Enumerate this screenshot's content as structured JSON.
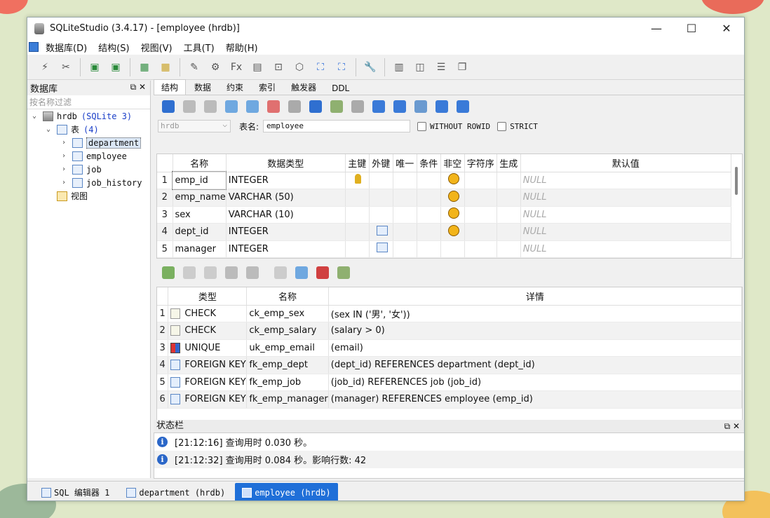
{
  "window": {
    "title": "SQLiteStudio (3.4.17) - [employee (hrdb)]"
  },
  "menu": [
    "数据库(D)",
    "结构(S)",
    "视图(V)",
    "工具(T)",
    "帮助(H)"
  ],
  "sidebar": {
    "title": "数据库",
    "filter_placeholder": "按名称过滤",
    "db_name": "hrdb",
    "db_type": "(SQLite 3)",
    "tables_label": "表",
    "tables_count": "(4)",
    "tables": [
      "department",
      "employee",
      "job",
      "job_history"
    ],
    "views_label": "视图"
  },
  "tabs": [
    "结构",
    "数据",
    "约束",
    "索引",
    "触发器",
    "DDL"
  ],
  "table_form": {
    "db": "hrdb",
    "name_label": "表名:",
    "name": "employee",
    "without_rowid": "WITHOUT ROWID",
    "strict": "STRICT"
  },
  "columns_grid": {
    "headers": [
      "名称",
      "数据类型",
      "主键",
      "外键",
      "唯一",
      "条件",
      "非空",
      "字符序",
      "生成",
      "默认值"
    ],
    "rows": [
      {
        "n": "1",
        "name": "emp_id",
        "type": "INTEGER",
        "pk": true,
        "fk": false,
        "nn": true,
        "default": "NULL"
      },
      {
        "n": "2",
        "name": "emp_name",
        "type": "VARCHAR (50)",
        "pk": false,
        "fk": false,
        "nn": true,
        "default": "NULL"
      },
      {
        "n": "3",
        "name": "sex",
        "type": "VARCHAR (10)",
        "pk": false,
        "fk": false,
        "nn": true,
        "default": "NULL"
      },
      {
        "n": "4",
        "name": "dept_id",
        "type": "INTEGER",
        "pk": false,
        "fk": true,
        "nn": true,
        "default": "NULL"
      },
      {
        "n": "5",
        "name": "manager",
        "type": "INTEGER",
        "pk": false,
        "fk": true,
        "nn": false,
        "default": "NULL"
      }
    ]
  },
  "constraints_grid": {
    "headers": [
      "类型",
      "名称",
      "详情"
    ],
    "rows": [
      {
        "n": "1",
        "type": "CHECK",
        "icon": "check-constraint-icon",
        "name": "ck_emp_sex",
        "detail": "(sex IN ('男', '女'))"
      },
      {
        "n": "2",
        "type": "CHECK",
        "icon": "check-constraint-icon",
        "name": "ck_emp_salary",
        "detail": "(salary > 0)"
      },
      {
        "n": "3",
        "type": "UNIQUE",
        "icon": "unique-constraint-icon",
        "name": "uk_emp_email",
        "detail": "(email)"
      },
      {
        "n": "4",
        "type": "FOREIGN KEY",
        "icon": "foreign-key-icon",
        "name": "fk_emp_dept",
        "detail": "(dept_id) REFERENCES department (dept_id)"
      },
      {
        "n": "5",
        "type": "FOREIGN KEY",
        "icon": "foreign-key-icon",
        "name": "fk_emp_job",
        "detail": "(job_id) REFERENCES job (job_id)"
      },
      {
        "n": "6",
        "type": "FOREIGN KEY",
        "icon": "foreign-key-icon",
        "name": "fk_emp_manager",
        "detail": "(manager) REFERENCES employee (emp_id)"
      }
    ]
  },
  "status": {
    "title": "状态栏",
    "lines": [
      "[21:12:16]  查询用时 0.030 秒。",
      "[21:12:32]  查询用时 0.084 秒。影响行数: 42"
    ]
  },
  "bottom_tabs": [
    "SQL 编辑器 1",
    "department (hrdb)",
    "employee (hrdb)"
  ]
}
